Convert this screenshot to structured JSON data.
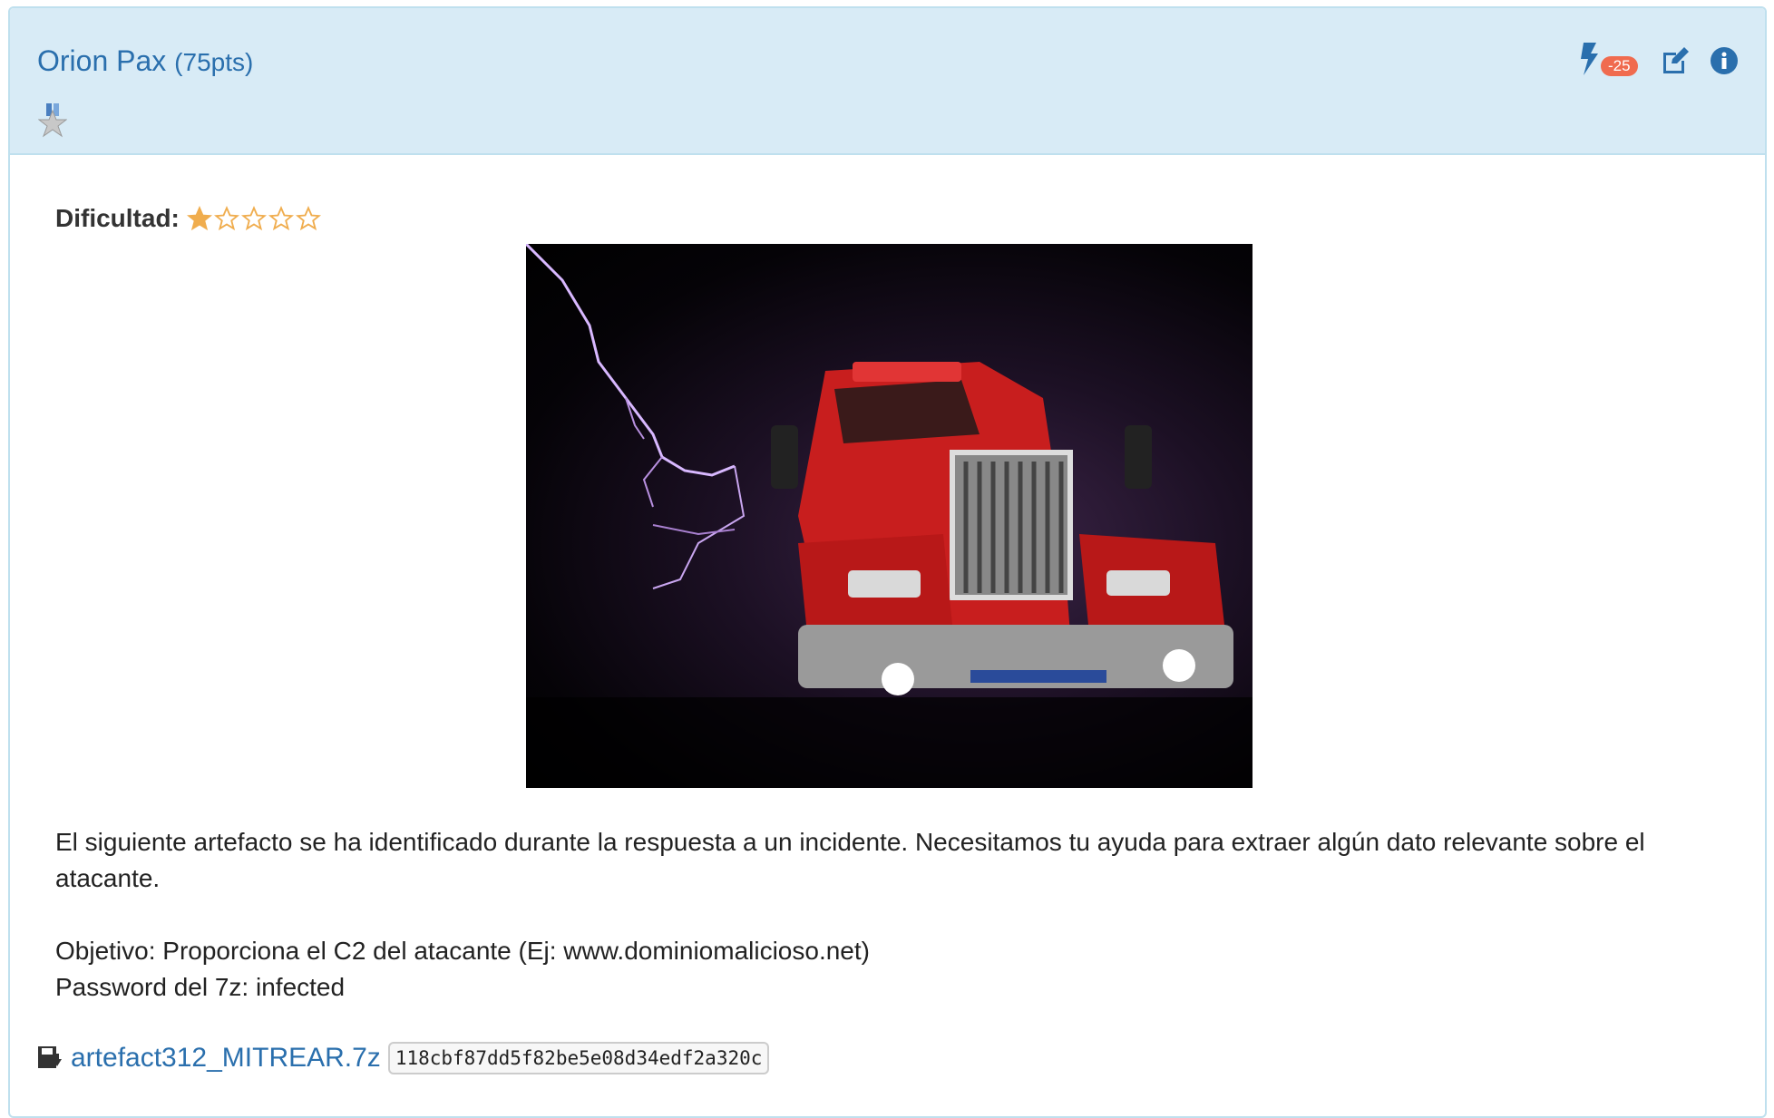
{
  "header": {
    "name": "Orion Pax",
    "points": "(75pts)",
    "badge_count": "-25",
    "icons": [
      "medal-star-icon",
      "bolt-icon",
      "edit-icon",
      "info-icon"
    ]
  },
  "difficulty": {
    "label": "Dificultad:",
    "rating": 1,
    "max": 5
  },
  "image": {
    "description_icon": "challenge-image"
  },
  "description": {
    "paragraph1": "El siguiente artefacto se ha identificado durante la respuesta a un incidente. Necesitamos tu ayuda para extraer algún dato relevante sobre el atacante.",
    "objective": "Objetivo: Proporciona el C2 del atacante (Ej: www.dominiomalicioso.net)",
    "password": "Password del 7z: infected"
  },
  "attachment": {
    "filename": "artefact312_MITREAR.7z",
    "hash": "118cbf87dd5f82be5e08d34edf2a320c",
    "icon": "download-file-icon"
  },
  "colors": {
    "header_bg": "#d8ebf6",
    "link": "#2a6fad",
    "badge": "#f06b4f",
    "star": "#f0ad4e"
  }
}
